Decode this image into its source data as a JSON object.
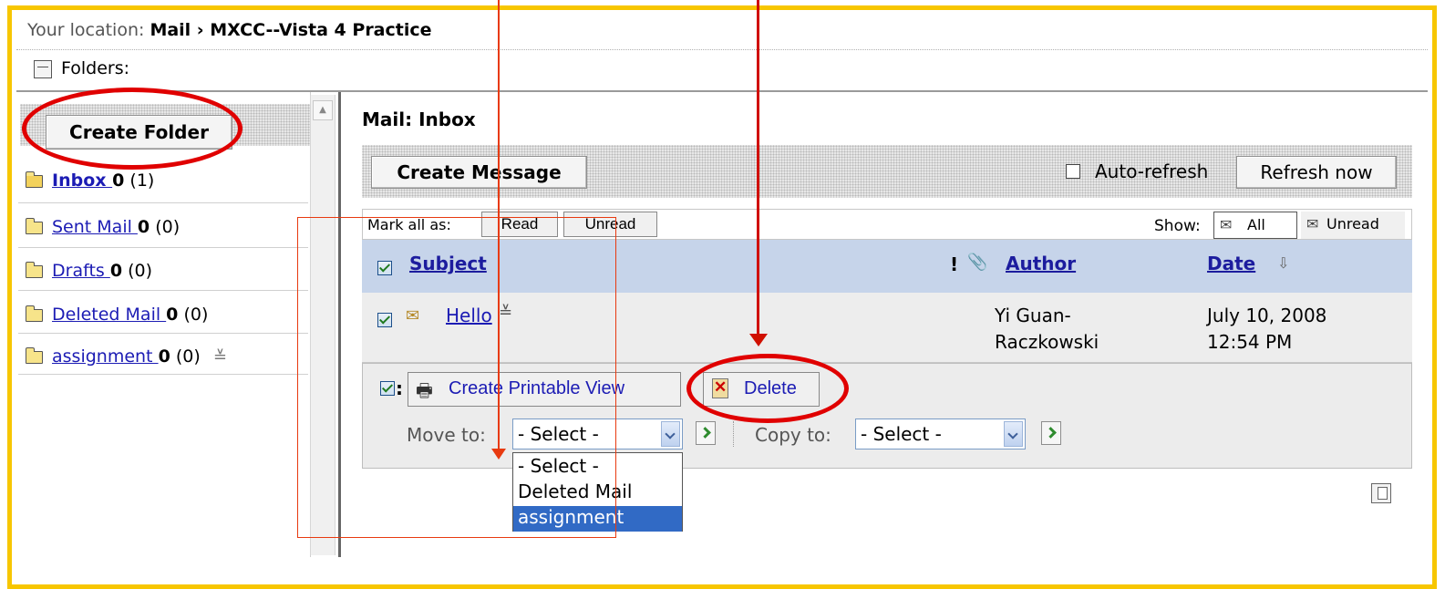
{
  "breadcrumb": {
    "prefix": "Your location:",
    "path": "Mail › MXCC--Vista 4 Practice"
  },
  "folders_label": "Folders:",
  "sidebar": {
    "create_folder_label": "Create Folder",
    "items": [
      {
        "name": "Inbox ",
        "unread": "0",
        "total": "(1)"
      },
      {
        "name": "Sent Mail ",
        "unread": "0",
        "total": "(0)"
      },
      {
        "name": "Drafts ",
        "unread": "0",
        "total": "(0)"
      },
      {
        "name": "Deleted Mail ",
        "unread": "0",
        "total": "(0)"
      },
      {
        "name": "assignment ",
        "unread": "0",
        "total": "(0)"
      }
    ]
  },
  "main": {
    "title": "Mail: Inbox",
    "create_message_label": "Create Message",
    "auto_refresh_label": "Auto-refresh",
    "refresh_now_label": "Refresh now",
    "mark_all_label": "Mark all as:",
    "read_label": "Read",
    "unread_label": "Unread",
    "show_label": "Show:",
    "show_all_label": "All",
    "show_unread_label": "Unread",
    "table": {
      "columns": {
        "subject": "Subject",
        "priority": "!",
        "author": "Author",
        "date": "Date"
      },
      "rows": [
        {
          "subject": "Hello",
          "author_line1": "Yi Guan-",
          "author_line2": "Raczkowski",
          "date_line1": "July 10, 2008",
          "date_line2": "12:54 PM"
        }
      ]
    },
    "actions": {
      "printable_view_label": "Create Printable View",
      "delete_label": "Delete",
      "move_to_label": "Move to:",
      "copy_to_label": "Copy to:",
      "move_select_value": "- Select -",
      "copy_select_value": "- Select -",
      "move_options": [
        "- Select -",
        "Deleted Mail",
        "assignment"
      ]
    }
  },
  "colors": {
    "frame": "#f7c600",
    "annotation_red": "#e00000",
    "link": "#1c1cb4",
    "header_bg": "#c6d4ea",
    "selection": "#316ac5"
  },
  "icons": [
    "folders-toggle-icon",
    "folder-icon",
    "mail-envelope-icon",
    "attachment-icon",
    "printer-icon",
    "delete-icon",
    "go-arrow-icon",
    "sort-down-icon",
    "copy-icon"
  ]
}
